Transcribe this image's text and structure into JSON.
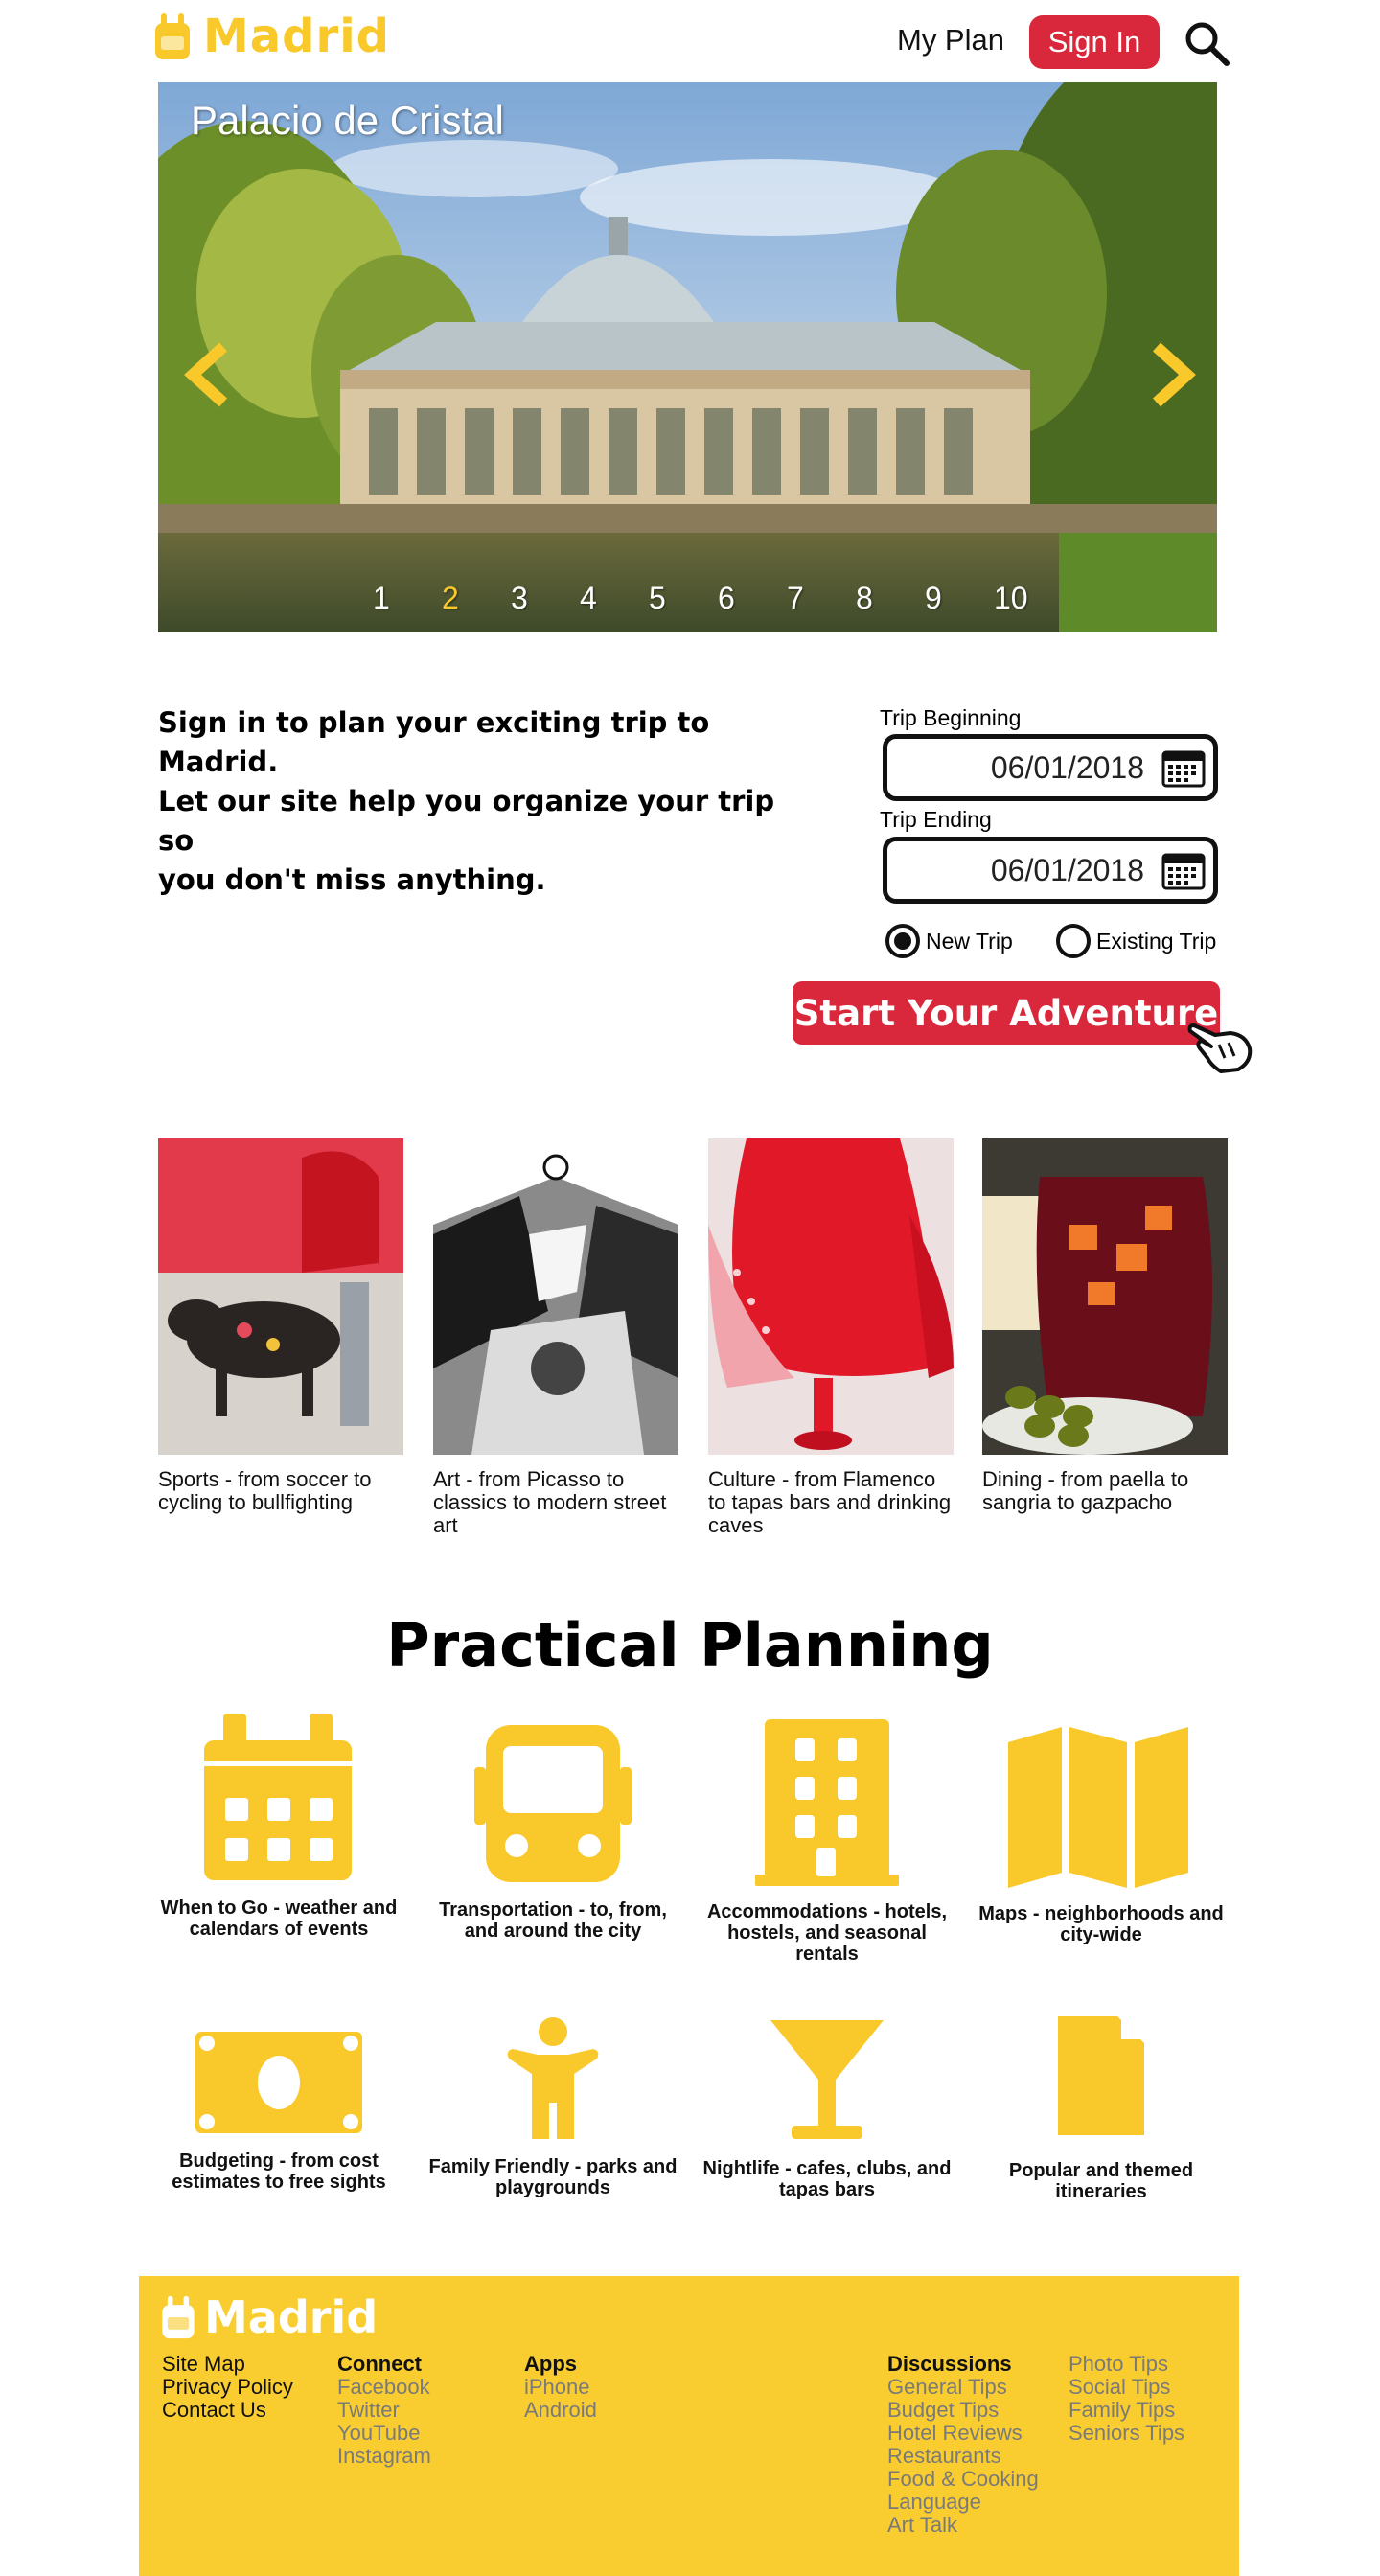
{
  "header": {
    "logo_text": "Madrid",
    "logo_icon": "backpack-icon",
    "my_plan": "My Plan",
    "sign_in": "Sign In",
    "search_icon": "search-icon"
  },
  "hero": {
    "caption": "Palacio de Cristal",
    "slides": [
      "1",
      "2",
      "3",
      "4",
      "5",
      "6",
      "7",
      "8",
      "9",
      "10"
    ],
    "active_slide": "2",
    "prev_icon": "chevron-left-icon",
    "next_icon": "chevron-right-icon"
  },
  "intro": {
    "line1": "Sign in to plan your exciting trip to Madrid.",
    "line2": "Let our site help you organize your trip so",
    "line3": "you don't miss anything."
  },
  "trip_form": {
    "begin_label": "Trip Beginning",
    "begin_value": "06/01/2018",
    "end_label": "Trip Ending",
    "end_value": "06/01/2018",
    "radio_new": "New Trip",
    "radio_existing": "Existing Trip",
    "selected_radio": "New Trip",
    "start_button": "Start Your Adventure"
  },
  "categories": [
    {
      "text": "Sports - from soccer to cycling to bullfighting"
    },
    {
      "text": "Art - from Picasso to classics to modern street art"
    },
    {
      "text": "Culture - from Flamenco to tapas bars and drinking caves"
    },
    {
      "text": "Dining - from paella to sangria to gazpacho"
    }
  ],
  "practical": {
    "title": "Practical Planning",
    "items": [
      {
        "label": "When to Go - weather and calendars of events",
        "icon": "calendar-icon"
      },
      {
        "label": "Transportation - to, from, and around the city",
        "icon": "bus-icon"
      },
      {
        "label": "Accommodations - hotels, hostels, and seasonal rentals",
        "icon": "building-icon"
      },
      {
        "label": "Maps - neighborhoods and city-wide",
        "icon": "map-icon"
      },
      {
        "label": "Budgeting - from cost estimates to free sights",
        "icon": "money-icon"
      },
      {
        "label": "Family Friendly - parks and playgrounds",
        "icon": "child-icon"
      },
      {
        "label": "Nightlife - cafes, clubs, and tapas bars",
        "icon": "cocktail-icon"
      },
      {
        "label": "Popular and themed itineraries",
        "icon": "document-icon"
      }
    ]
  },
  "footer": {
    "logo_text": "Madrid",
    "col1": [
      "Site Map",
      "Privacy Policy",
      "Contact Us"
    ],
    "connect": {
      "heading": "Connect",
      "links": [
        "Facebook",
        "Twitter",
        "YouTube",
        "Instagram"
      ]
    },
    "apps": {
      "heading": "Apps",
      "links": [
        "iPhone",
        "Android"
      ]
    },
    "discussions": {
      "heading": "Discussions",
      "links": [
        "General Tips",
        "Budget Tips",
        "Hotel Reviews",
        "Restaurants",
        "Food & Cooking",
        "Language",
        "Art Talk"
      ]
    },
    "tips": [
      "Photo Tips",
      "Social Tips",
      "Family Tips",
      "Seniors Tips"
    ]
  },
  "colors": {
    "accent_yellow": "#f9c92c",
    "accent_red": "#d9283b"
  }
}
